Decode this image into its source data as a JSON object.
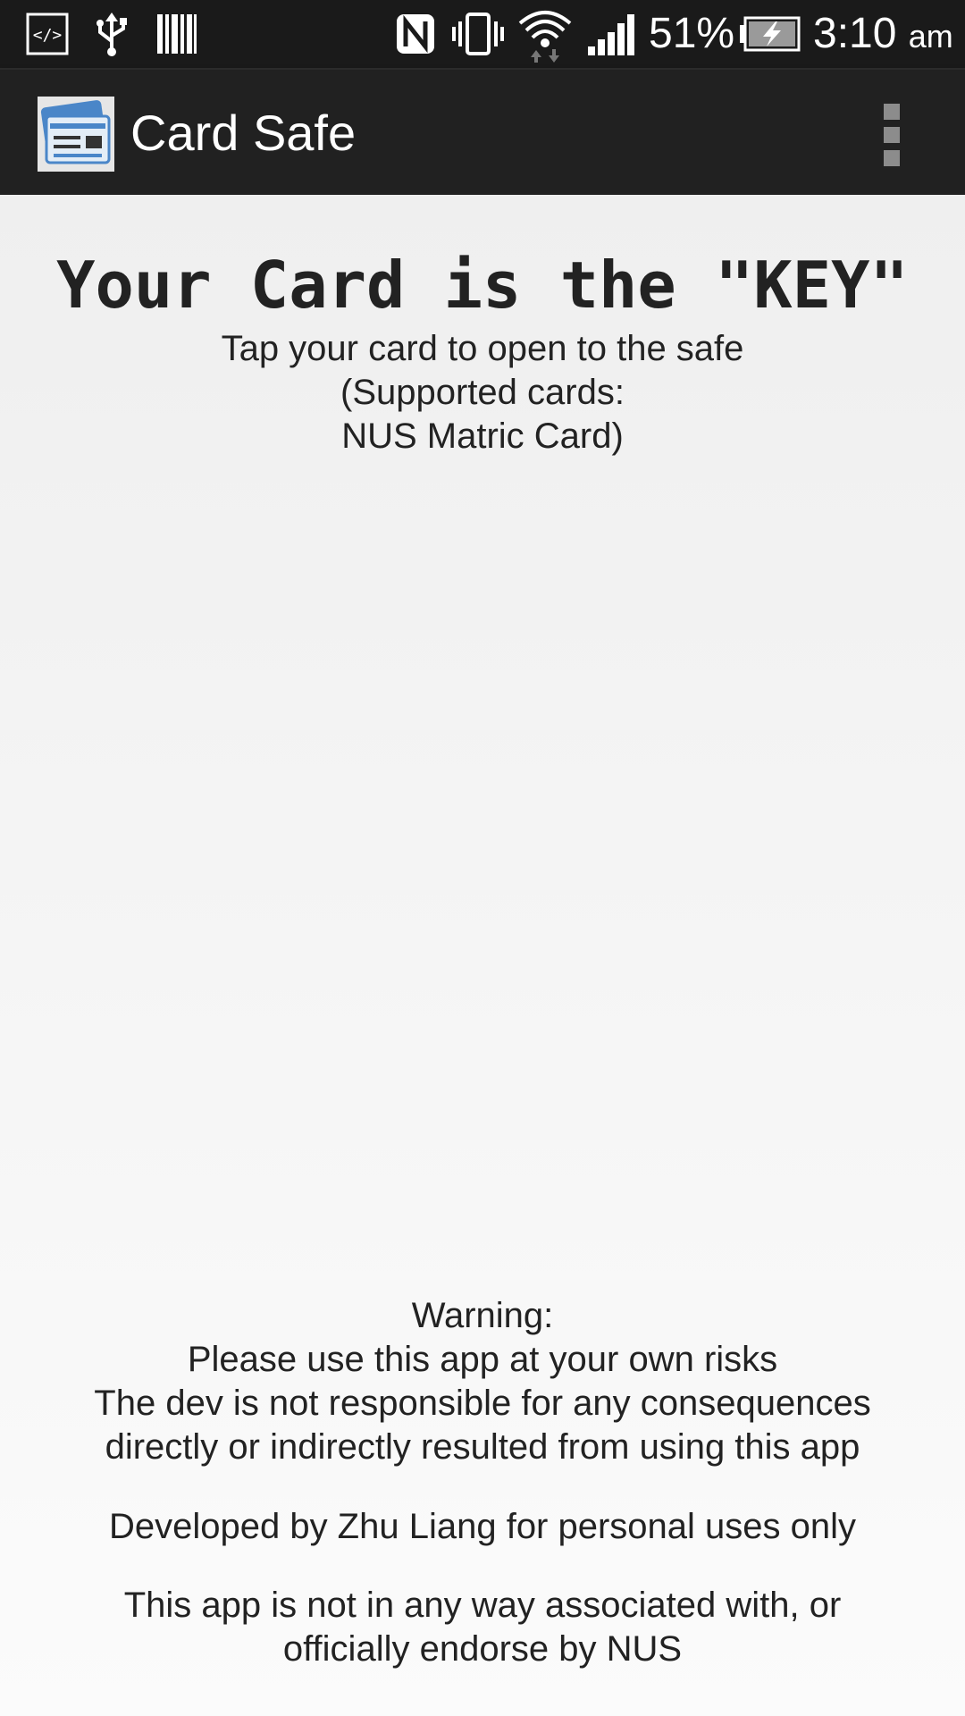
{
  "status_bar": {
    "battery_percent": "51%",
    "time": "3:10",
    "am_pm": "am",
    "icons": [
      "developer-mode-icon",
      "usb-icon",
      "barcode-icon",
      "nfc-icon",
      "vibrate-icon",
      "wifi-icon",
      "signal-icon",
      "battery-charging-icon"
    ]
  },
  "action_bar": {
    "title": "Card Safe",
    "app_icon": "card-safe-app-icon",
    "overflow_icon": "more-vertical-icon"
  },
  "main": {
    "headline": "Your Card is the \"KEY\"",
    "instructions": [
      "Tap your card to open to the safe",
      "(Supported cards:",
      "NUS Matric Card)"
    ],
    "warning": [
      "Warning:",
      "Please use this app at your own risks",
      "The dev is not responsible for any consequences",
      "directly or indirectly resulted from using this app"
    ],
    "developer_note": "Developed by Zhu Liang for personal uses only",
    "disclaimer": [
      "This app is not in any way associated with, or",
      "officially endorse by NUS"
    ]
  },
  "colors": {
    "status_bar_bg": "#1a1a1a",
    "action_bar_bg": "#212121",
    "content_bg": "#f2f2f2",
    "text": "#222222"
  }
}
